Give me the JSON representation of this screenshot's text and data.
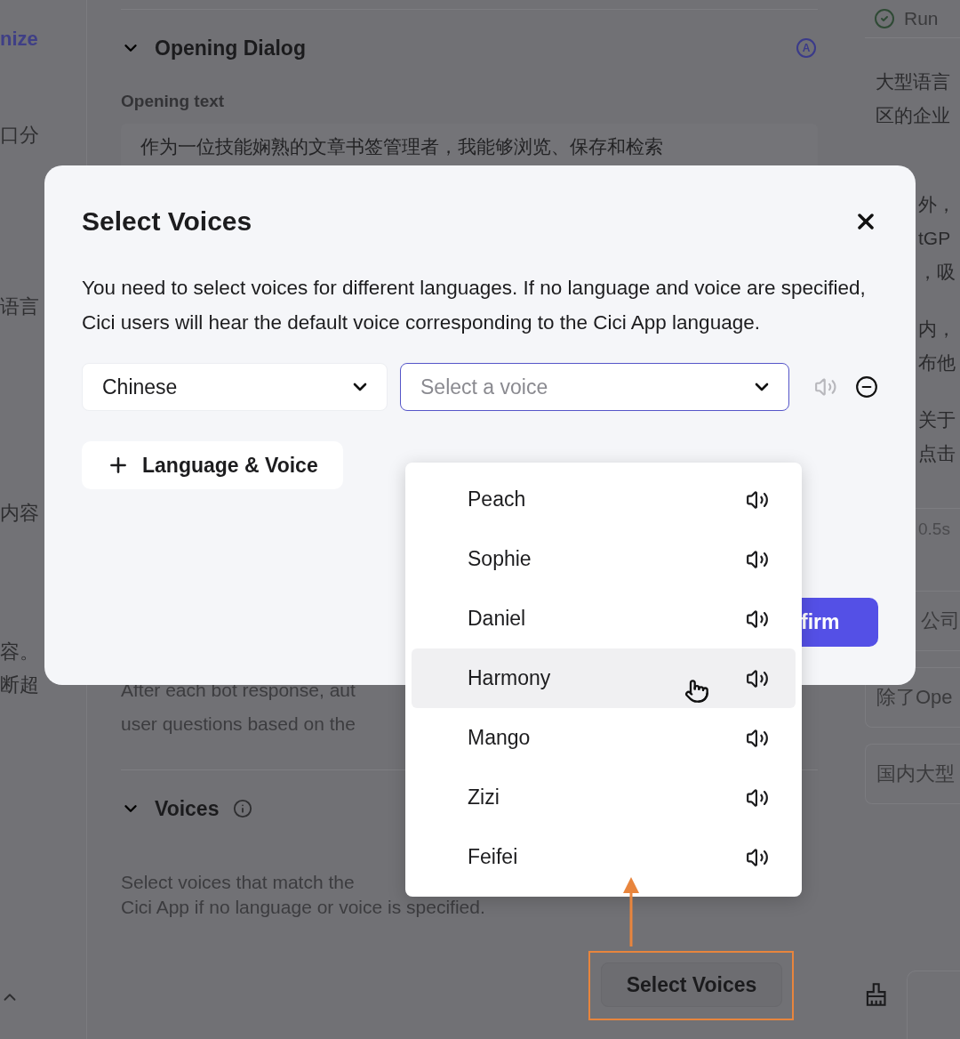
{
  "sidebar": {
    "items": [
      "nize",
      "口分",
      "语言",
      "内容",
      "容。",
      "断超"
    ]
  },
  "opening_dialog": {
    "title": "Opening Dialog",
    "expanded": true,
    "badge": "A",
    "label": "Opening text",
    "text": "作为一位技能娴熟的文章书签管理者，我能够浏览、保存和检索"
  },
  "suggestions_section": {
    "lines": [
      "After each bot response, aut",
      "user questions based on the"
    ]
  },
  "voices_section": {
    "title": "Voices",
    "expanded": true,
    "description_lines": [
      "Select voices that match the",
      "Cici App if no language or voice is specified."
    ],
    "button": "Select Voices"
  },
  "right_panel": {
    "run_label": "Run",
    "paragraphs": [
      {
        "lines": [
          "大型语言",
          "区的企业"
        ]
      },
      {
        "lines": [
          "外，",
          "tGP",
          "，吸"
        ]
      },
      {
        "lines": [
          "内，",
          "布他"
        ]
      },
      {
        "lines": [
          "关于",
          "点击"
        ]
      }
    ],
    "timing": "0.5s",
    "suggestions": [
      "公司",
      "除了Ope",
      "国内大型"
    ]
  },
  "dialog": {
    "title": "Select Voices",
    "description": "You need to select voices for different languages. If no language and voice are specified, Cici users will hear the default voice corresponding to the Cici App language.",
    "rows": [
      {
        "language": "Chinese",
        "voice_placeholder": "Select a voice",
        "focused": true
      }
    ],
    "add_button": "Language & Voice",
    "confirm_button": "firm"
  },
  "voice_menu": {
    "options": [
      {
        "name": "Peach",
        "highlighted": false
      },
      {
        "name": "Sophie",
        "highlighted": false
      },
      {
        "name": "Daniel",
        "highlighted": false
      },
      {
        "name": "Harmony",
        "highlighted": true
      },
      {
        "name": "Mango",
        "highlighted": false
      },
      {
        "name": "Zizi",
        "highlighted": false
      },
      {
        "name": "Feifei",
        "highlighted": false
      }
    ]
  }
}
